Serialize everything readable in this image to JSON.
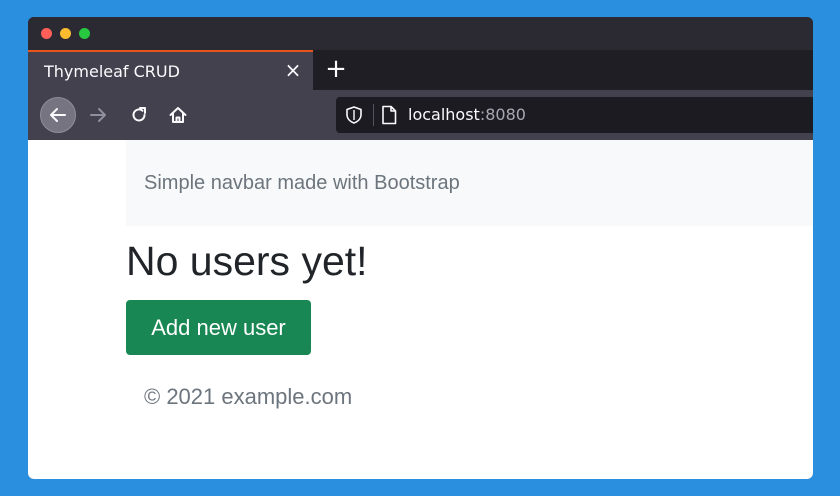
{
  "browser": {
    "tab": {
      "title": "Thymeleaf CRUD",
      "close_icon": "×"
    },
    "new_tab_icon": "+",
    "address": {
      "host": "localhost",
      "port": ":8080"
    }
  },
  "page": {
    "navbar_brand": "Simple navbar made with Bootstrap",
    "heading": "No users yet!",
    "add_button_label": "Add new user",
    "footer_text": "© 2021 example.com"
  },
  "colors": {
    "desktop_bg": "#2b8fdf",
    "tab_accent": "#e8541c",
    "button_success": "#198754",
    "muted_text": "#6c757d"
  },
  "icons": [
    "close-icon",
    "plus-icon",
    "back-arrow-icon",
    "forward-arrow-icon",
    "reload-icon",
    "home-icon",
    "shield-icon",
    "page-icon"
  ]
}
